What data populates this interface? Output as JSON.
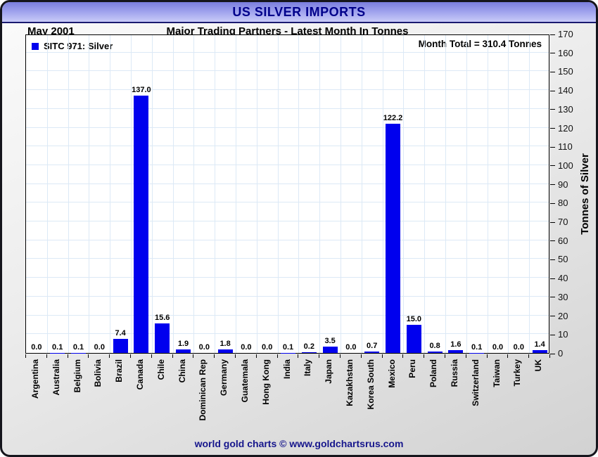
{
  "window": {
    "title": "US SILVER IMPORTS",
    "footer": "world gold charts © www.goldchartsrus.com"
  },
  "header": {
    "date": "May 2001",
    "subtitle": "Major Trading Partners - Latest Month In Tonnes"
  },
  "legend": {
    "label": "SITC 971: Silver",
    "marker_color": "#0000ee",
    "position": "top-left"
  },
  "annotation": {
    "month_total": "Month Total = 310.4 Tonnes"
  },
  "chart_data": {
    "type": "bar",
    "title": "US SILVER IMPORTS",
    "subtitle": "Major Trading Partners - Latest Month In Tonnes",
    "series_name": "SITC 971: Silver",
    "categories": [
      "Argentina",
      "Australia",
      "Belgium",
      "Bolivia",
      "Brazil",
      "Canada",
      "Chile",
      "China",
      "Dominican Rep",
      "Germany",
      "Guatemala",
      "Hong Kong",
      "India",
      "Italy",
      "Japan",
      "Kazakhstan",
      "Korea South",
      "Mexico",
      "Peru",
      "Poland",
      "Russia",
      "Switzerland",
      "Taiwan",
      "Turkey",
      "UK"
    ],
    "values": [
      0.0,
      0.1,
      0.1,
      0.0,
      7.4,
      137.0,
      15.6,
      1.9,
      0.0,
      1.8,
      0.0,
      0.0,
      0.1,
      0.2,
      3.5,
      0.0,
      0.7,
      122.2,
      15.0,
      0.8,
      1.6,
      0.1,
      0.0,
      0.0,
      1.4
    ],
    "xlabel": "",
    "ylabel": "Tonnes of Silver",
    "ylim": [
      0,
      170
    ],
    "yticks": [
      0,
      10,
      20,
      30,
      40,
      50,
      60,
      70,
      80,
      90,
      100,
      110,
      120,
      130,
      140,
      150,
      160,
      170
    ],
    "yaxis_side": "right",
    "grid": true,
    "value_labels": true,
    "bar_color": "#0000ee",
    "grid_color": "#dce9f6"
  }
}
